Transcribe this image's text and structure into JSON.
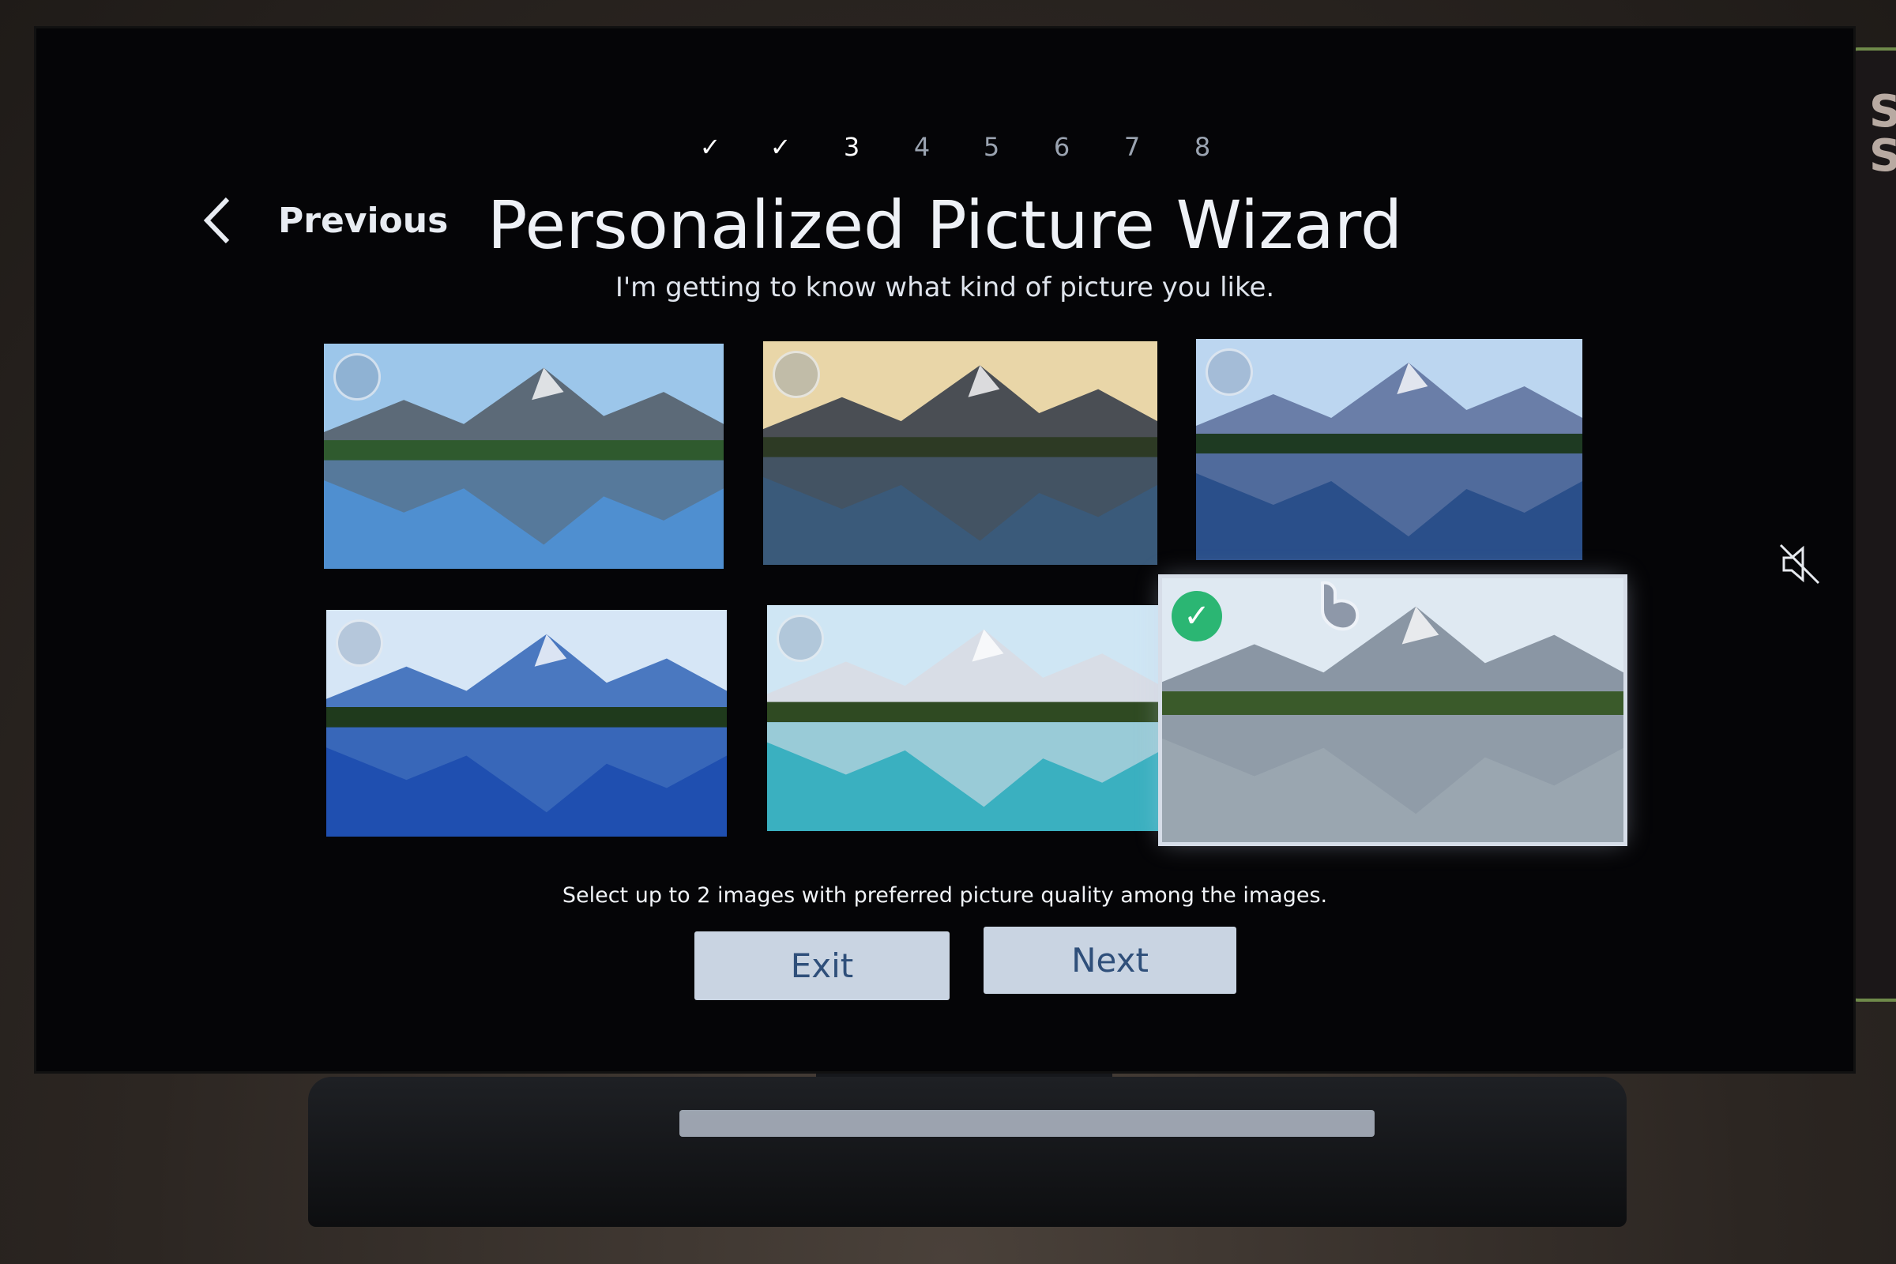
{
  "wizard": {
    "steps": [
      {
        "label": "✓",
        "state": "done"
      },
      {
        "label": "✓",
        "state": "done"
      },
      {
        "label": "3",
        "state": "current"
      },
      {
        "label": "4",
        "state": "pending"
      },
      {
        "label": "5",
        "state": "pending"
      },
      {
        "label": "6",
        "state": "pending"
      },
      {
        "label": "7",
        "state": "pending"
      },
      {
        "label": "8",
        "state": "pending"
      }
    ],
    "previous_label": "Previous",
    "title": "Personalized Picture Wizard",
    "subtitle": "I'm getting to know what kind of picture you like.",
    "images": [
      {
        "selected": false
      },
      {
        "selected": false
      },
      {
        "selected": false
      },
      {
        "selected": false
      },
      {
        "selected": false
      },
      {
        "selected": true
      }
    ],
    "hint": "Select up to 2 images with preferred picture quality among the images.",
    "exit_label": "Exit",
    "next_label": "Next",
    "check_glyph": "✓"
  },
  "icons": {
    "previous": "chevron-left-icon",
    "mute": "speaker-muted-icon",
    "cursor": "pointer-hand-icon"
  },
  "colors": {
    "accent_check": "#2bb673",
    "button_bg": "#c9d4e2",
    "button_text": "#2f4f7a",
    "screen_bg": "#050507"
  }
}
